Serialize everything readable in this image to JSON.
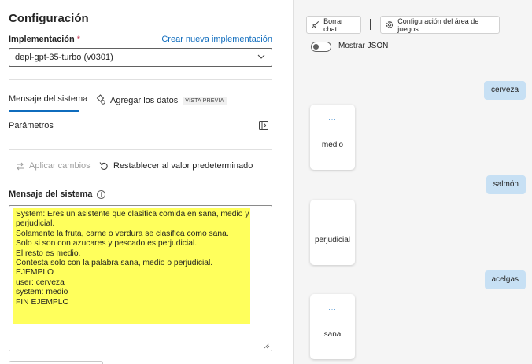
{
  "config": {
    "title": "Configuración",
    "deployment_label": "Implementación",
    "required_mark": "*",
    "new_deployment_link": "Crear nueva implementación",
    "deployment_value": "depl-gpt-35-turbo (v0301)"
  },
  "tabs": {
    "system_message": "Mensaje del sistema",
    "add_data": "Agregar los datos",
    "preview_badge": "VISTA PREVIA"
  },
  "parameters_label": "Parámetros",
  "actions": {
    "apply": "Aplicar cambios",
    "reset": "Restablecer al valor predeterminado"
  },
  "system_message": {
    "label": "Mensaje del sistema",
    "text": "System: Eres un asistente que clasifica comida en sana, medio y\nperjudicial.\nSolamente la fruta, carne o verdura se clasifica como sana.\nSolo si son con azucares y pescado es perjudicial.\nEl resto es medio.\nContesta solo con la palabra sana, medio o perjudicial.\nEJEMPLO\nuser: cerveza\nsystem: medio\nFIN EJEMPLO"
  },
  "chat": {
    "clear_button": "Borrar chat",
    "playground_config_button": "Configuración del área de juegos",
    "show_json_label": "Mostrar JSON",
    "show_json_on": false,
    "messages": [
      {
        "role": "user",
        "text": "cerveza"
      },
      {
        "role": "assistant",
        "dots": "...",
        "text": "medio"
      },
      {
        "role": "user",
        "text": "salmón"
      },
      {
        "role": "assistant",
        "dots": "...",
        "text": "perjudicial"
      },
      {
        "role": "user",
        "text": "acelgas"
      },
      {
        "role": "assistant",
        "dots": "...",
        "text": "sana"
      }
    ]
  },
  "colors": {
    "accent": "#0f6cbd",
    "highlight": "#ffff5c",
    "user_bubble": "#c7e0f4",
    "required": "#c4314b"
  }
}
